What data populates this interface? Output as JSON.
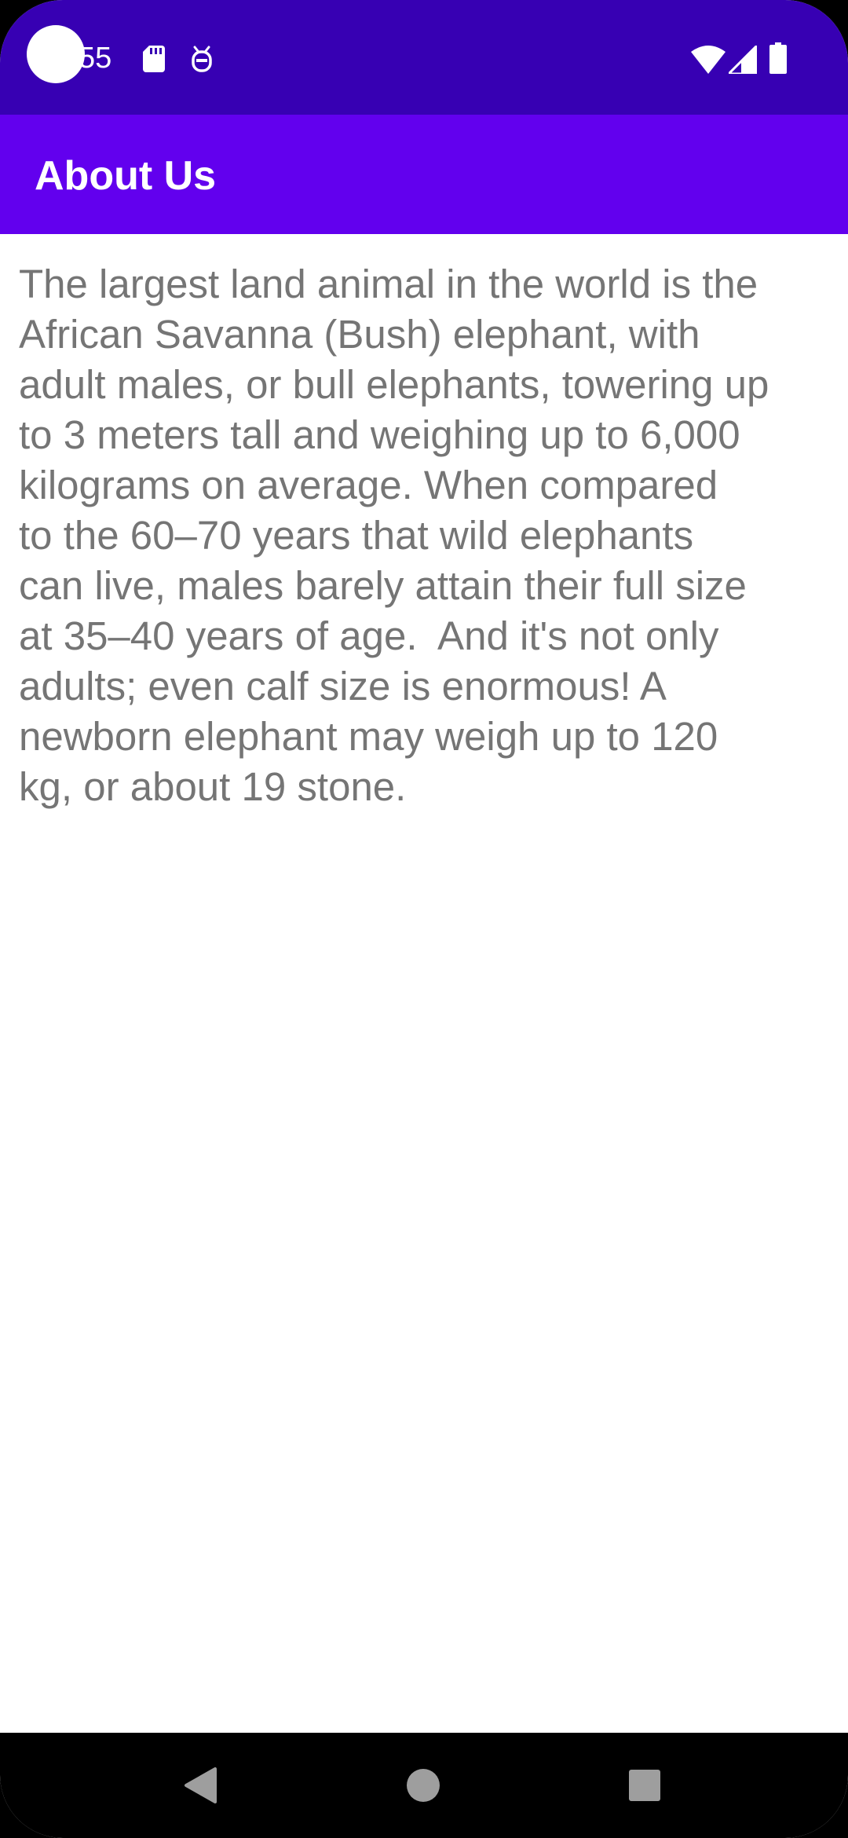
{
  "status_bar": {
    "time": "55",
    "icons": [
      "sd-card-icon",
      "debug-icon",
      "wifi-icon",
      "cell-signal-icon",
      "battery-icon"
    ]
  },
  "app_bar": {
    "title": "About Us"
  },
  "content": {
    "text": "The largest land animal in the world is the\nAfrican Savanna (Bush) elephant, with\nadult males, or bull elephants, towering up\nto 3 meters tall and weighing up to 6,000\nkilograms on average. When compared\nto the 60–70 years that wild elephants\ncan live, males barely attain their full size\nat 35–40 years of age.  And it's not only\nadults; even calf size is enormous! A\nnewborn elephant may weigh up to 120\nkg, or about 19 stone."
  },
  "nav_bar": {
    "buttons": [
      "back-icon",
      "home-icon",
      "recents-icon"
    ]
  },
  "colors": {
    "status_bar": "#3700b3",
    "app_bar": "#6200ee",
    "body_text": "#757575",
    "background": "#ffffff",
    "nav_bar": "#000000"
  }
}
